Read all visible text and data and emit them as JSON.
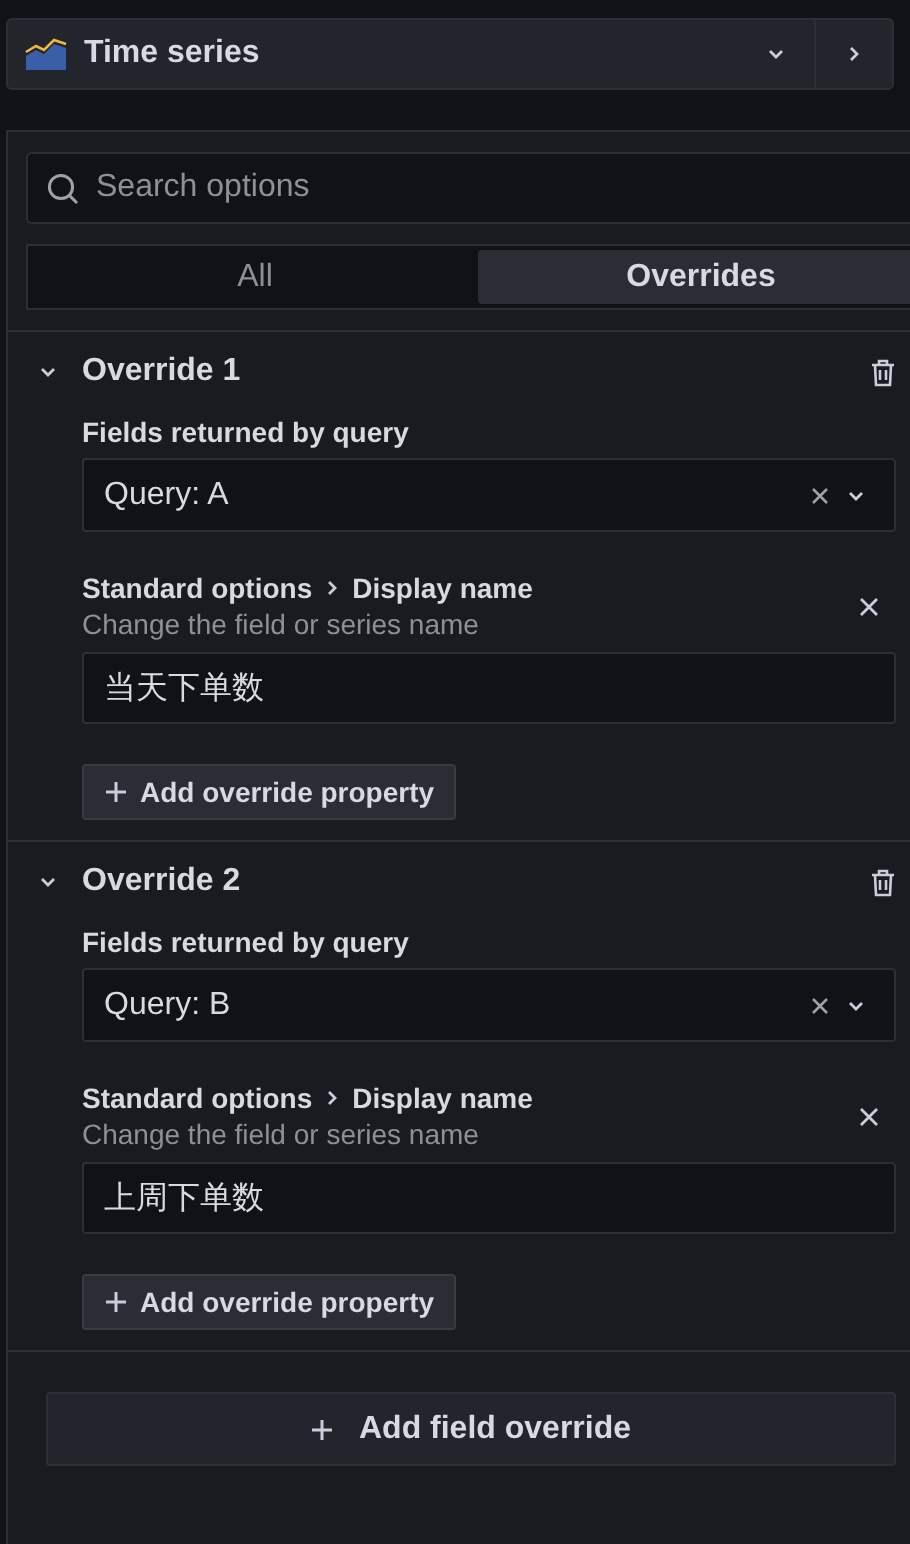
{
  "visualization": {
    "name": "Time series"
  },
  "search": {
    "placeholder": "Search options"
  },
  "tabs": [
    {
      "label": "All",
      "selected": false
    },
    {
      "label": "Overrides",
      "selected": true
    }
  ],
  "overrides": [
    {
      "title": "Override 1",
      "expanded": true,
      "matcher_label": "Fields returned by query",
      "matcher_value": "Query: A",
      "property": {
        "category": "Standard options",
        "name": "Display name",
        "description": "Change the field or series name",
        "value": "当天下单数"
      },
      "add_label": "Add override property"
    },
    {
      "title": "Override 2",
      "expanded": true,
      "matcher_label": "Fields returned by query",
      "matcher_value": "Query: B",
      "property": {
        "category": "Standard options",
        "name": "Display name",
        "description": "Change the field or series name",
        "value": "上周下单数"
      },
      "add_label": "Add override property"
    }
  ],
  "add_field_override": "Add field override"
}
